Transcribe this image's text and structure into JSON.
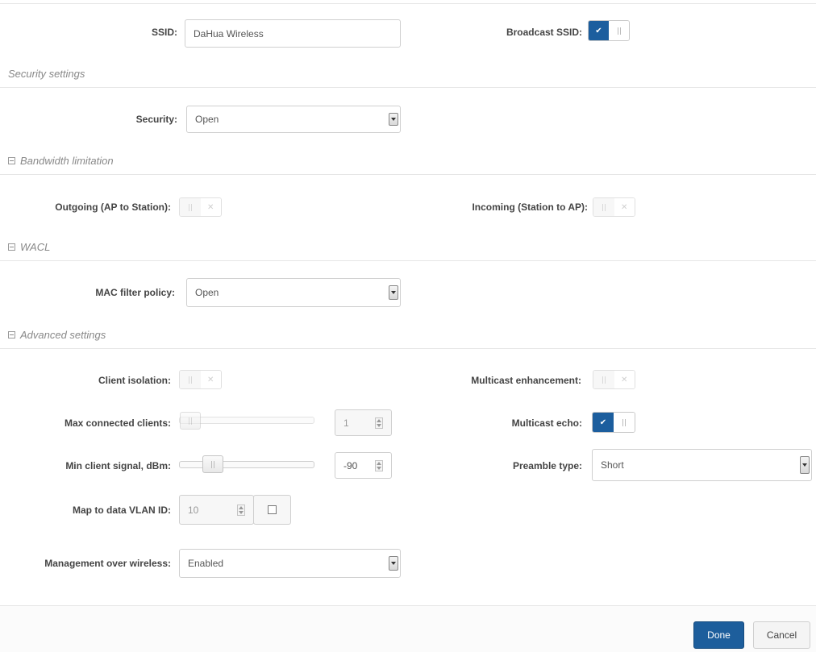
{
  "ssid": {
    "label": "SSID:",
    "value": "DaHua Wireless"
  },
  "broadcast_ssid": {
    "label": "Broadcast SSID:",
    "enabled": true
  },
  "sections": {
    "security": "Security settings",
    "bandwidth": "Bandwidth limitation",
    "wacl": "WACL",
    "advanced": "Advanced settings"
  },
  "security": {
    "label": "Security:",
    "value": "Open"
  },
  "bandwidth": {
    "outgoing_label": "Outgoing (AP to Station):",
    "outgoing_enabled": false,
    "incoming_label": "Incoming (Station to AP):",
    "incoming_enabled": false
  },
  "wacl": {
    "mac_filter_label": "MAC filter policy:",
    "mac_filter_value": "Open"
  },
  "advanced": {
    "client_isolation_label": "Client isolation:",
    "client_isolation_enabled": false,
    "multicast_enhancement_label": "Multicast enhancement:",
    "multicast_enhancement_enabled": false,
    "max_clients_label": "Max connected clients:",
    "max_clients_value": "1",
    "multicast_echo_label": "Multicast echo:",
    "multicast_echo_enabled": true,
    "min_signal_label": "Min client signal, dBm:",
    "min_signal_value": "-90",
    "preamble_label": "Preamble type:",
    "preamble_value": "Short",
    "vlan_label": "Map to data VLAN ID:",
    "vlan_value": "10",
    "mgmt_label": "Management over wireless:",
    "mgmt_value": "Enabled"
  },
  "buttons": {
    "done": "Done",
    "cancel": "Cancel"
  },
  "colors": {
    "accent": "#1d5e9c",
    "divider": "#e6e6e6"
  },
  "icons": {
    "switch_on": "check-icon",
    "switch_off": "x-icon",
    "section_collapse": "minus-square-icon"
  }
}
